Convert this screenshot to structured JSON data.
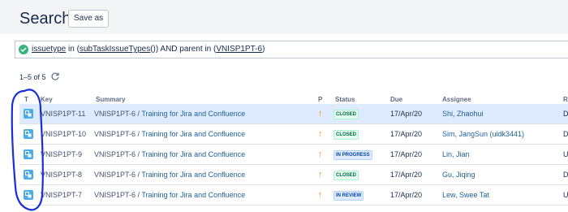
{
  "header": {
    "title": "Search",
    "save_label": "Save as"
  },
  "query": {
    "status_icon": "check-circle-icon",
    "parts": [
      "issuetype",
      " in ",
      "(",
      "subTaskIssueTypes",
      "()) AND parent in ",
      "(",
      "VNISP1PT-6",
      ")"
    ]
  },
  "results": {
    "count_text": "1–5 of 5"
  },
  "table": {
    "headers": {
      "type": "T",
      "key": "Key",
      "summary": "Summary",
      "priority": "P",
      "status": "Status",
      "due": "Due",
      "assignee": "Assignee",
      "resolution": "R"
    },
    "rows": [
      {
        "key": "VNISP1PT-11",
        "parent": "VNISP1PT-6 /",
        "title": "Training for Jira and Confluence",
        "priority": "↑",
        "status": "CLOSED",
        "due": "17/Apr/20",
        "assignee": "Shi, Zhaohui",
        "resolution": "D"
      },
      {
        "key": "VNISP1PT-10",
        "parent": "VNISP1PT-6 /",
        "title": "Training for Jira and Confluence",
        "priority": "↑",
        "status": "CLOSED",
        "due": "17/Apr/20",
        "assignee": "Sim, JangSun (uidk3441)",
        "resolution": "D"
      },
      {
        "key": "VNISP1PT-9",
        "parent": "VNISP1PT-6 /",
        "title": "Training for Jira and Confluence",
        "priority": "↑",
        "status": "IN PROGRESS",
        "due": "17/Apr/20",
        "assignee": "Lin, Jian",
        "resolution": "U"
      },
      {
        "key": "VNISP1PT-8",
        "parent": "VNISP1PT-6 /",
        "title": "Training for Jira and Confluence",
        "priority": "↑",
        "status": "CLOSED",
        "due": "17/Apr/20",
        "assignee": "Gu, Jiqing",
        "resolution": "D"
      },
      {
        "key": "VNISP1PT-7",
        "parent": "VNISP1PT-6 /",
        "title": "Training for Jira and Confluence",
        "priority": "↑",
        "status": "IN REVIEW",
        "due": "17/Apr/20",
        "assignee": "Lew, Swee Tat",
        "resolution": "U"
      }
    ]
  },
  "colors": {
    "accent": "#0052cc",
    "link": "#1d5f9a",
    "priority": "#ff8b00",
    "closed": "#006644",
    "in_progress": "#0747a6",
    "selected_row": "#deebff",
    "annotation": "#1a2fd6"
  }
}
